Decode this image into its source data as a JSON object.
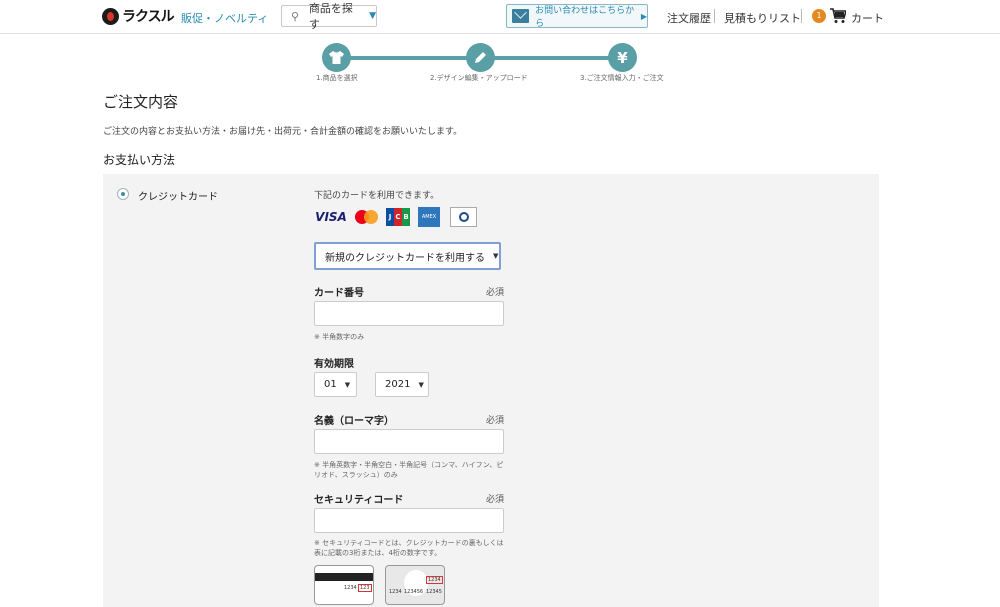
{
  "header": {
    "logo_text": "ラクスル",
    "nav_novelty": "販促・ノベルティ",
    "search_label": "商品を探す",
    "contact_label": "お問い合わせはこちらから",
    "links": [
      "注文履歴",
      "見積もりリスト"
    ],
    "cart_count": "1",
    "cart_label": "カート"
  },
  "stepper": {
    "steps": [
      {
        "label": "1.商品を選択",
        "icon": "tshirt-icon"
      },
      {
        "label": "2.デザイン編集・アップロード",
        "icon": "pencil-icon"
      },
      {
        "label": "3.ご注文情報入力・ご注文",
        "icon": "yen-icon"
      }
    ],
    "accent": "#5a9ea6"
  },
  "page": {
    "title": "ご注文内容",
    "description": "ご注文の内容とお支払い方法・お届け先・出荷元・合計金額の確認をお願いいたします。",
    "payment_section_title": "お支払い方法"
  },
  "payment": {
    "method_label": "クレジットカード",
    "cards_note": "下記のカードを利用できます。",
    "card_brands": [
      "VISA",
      "Mastercard",
      "JCB",
      "AMERICAN EXPRESS",
      "Diners Club"
    ],
    "card_select": "新規のクレジットカードを利用する",
    "card_number": {
      "label": "カード番号",
      "required": "必須",
      "value": "",
      "hint": "※ 半角数字のみ"
    },
    "expiry": {
      "label": "有効期限",
      "month": "01",
      "year": "2021"
    },
    "holder": {
      "label": "名義（ローマ字）",
      "required": "必須",
      "value": "",
      "hint": "※ 半角英数字・半角空白・半角記号（コンマ、ハイフン、ピリオド、スラッシュ）のみ"
    },
    "security": {
      "label": "セキュリティコード",
      "required": "必須",
      "value": "",
      "hint": "※ セキュリティコードとは、クレジットカードの裏もしくは表に記載の3桁または、4桁の数字です。"
    },
    "card_back": {
      "number": "1234",
      "code": "123"
    },
    "card_front": {
      "code": "1234",
      "numbers": [
        "1234",
        "123456",
        "12345"
      ]
    }
  }
}
